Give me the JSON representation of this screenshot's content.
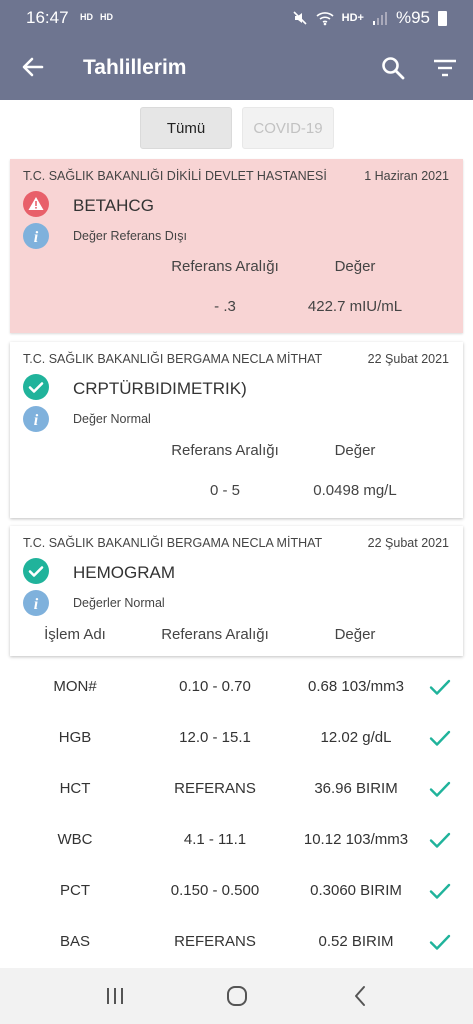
{
  "status_bar": {
    "time": "16:47",
    "hd1": "HD",
    "hd2": "HD",
    "network": "HD+",
    "battery": "%95"
  },
  "app_bar": {
    "title": "Tahlillerim"
  },
  "tabs": [
    {
      "label": "Tümü"
    },
    {
      "label": "COVID-19"
    }
  ],
  "cards": [
    {
      "hospital": "T.C. SAĞLIK BAKANLIĞI DİKİLİ DEVLET HASTANESİ",
      "date": "1 Haziran 2021",
      "test": "BETAHCG",
      "status": "Değer Referans Dışı",
      "range_header": "Referans Aralığı",
      "value_header": "Değer",
      "range": "- .3",
      "value": "422.7 mIU/mL"
    },
    {
      "hospital": "T.C. SAĞLIK BAKANLIĞI BERGAMA NECLA MİTHAT",
      "date": "22 Şubat 2021",
      "test": "CRPTÜRBIDIMETRIK)",
      "status": "Değer Normal",
      "range_header": "Referans Aralığı",
      "value_header": "Değer",
      "range": "0 - 5",
      "value": "0.0498 mg/L"
    },
    {
      "hospital": "T.C. SAĞLIK BAKANLIĞI BERGAMA NECLA MİTHAT",
      "date": "22 Şubat 2021",
      "test": "HEMOGRAM",
      "status": "Değerler Normal",
      "name_header": "İşlem Adı",
      "range_header": "Referans Aralığı",
      "value_header": "Değer"
    }
  ],
  "hemogram_rows": [
    {
      "name": "MON#",
      "range": "0.10 - 0.70",
      "value": "0.68 103/mm3"
    },
    {
      "name": "HGB",
      "range": "12.0 - 15.1",
      "value": "12.02 g/dL"
    },
    {
      "name": "HCT",
      "range": "REFERANS",
      "value": "36.96 BIRIM"
    },
    {
      "name": "WBC",
      "range": "4.1 - 11.1",
      "value": "10.12 103/mm3"
    },
    {
      "name": "PCT",
      "range": "0.150 - 0.500",
      "value": "0.3060 BIRIM"
    },
    {
      "name": "BAS",
      "range": "REFERANS",
      "value": "0.52 BIRIM"
    }
  ],
  "icons": {
    "back": "arrow-left-icon",
    "search": "search-icon",
    "filter": "filter-icon",
    "warning": "warning-icon",
    "check": "check-circle-icon",
    "info": "info-icon",
    "row_ok": "checkmark-icon"
  },
  "colors": {
    "app_bar": "#6e7590",
    "alert_card": "#f8d4d4",
    "warning_red": "#e8606a",
    "ok_teal": "#20b39b",
    "info_blue": "#7fb1dc"
  }
}
